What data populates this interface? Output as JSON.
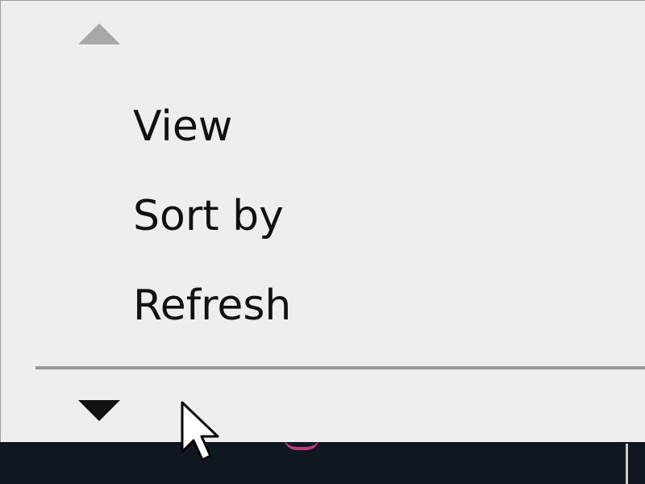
{
  "context_menu": {
    "items": [
      {
        "label": "View"
      },
      {
        "label": "Sort by"
      },
      {
        "label": "Refresh"
      }
    ],
    "scroll_up_icon": "triangle-up",
    "scroll_down_icon": "triangle-down"
  },
  "colors": {
    "menu_background": "#eeeeee",
    "menu_text": "#111111",
    "separator": "#9a9a9a",
    "taskbar": "#0f1820",
    "taskbar_accent": "#d63f8c"
  },
  "cursor_icon": "arrow-pointer"
}
